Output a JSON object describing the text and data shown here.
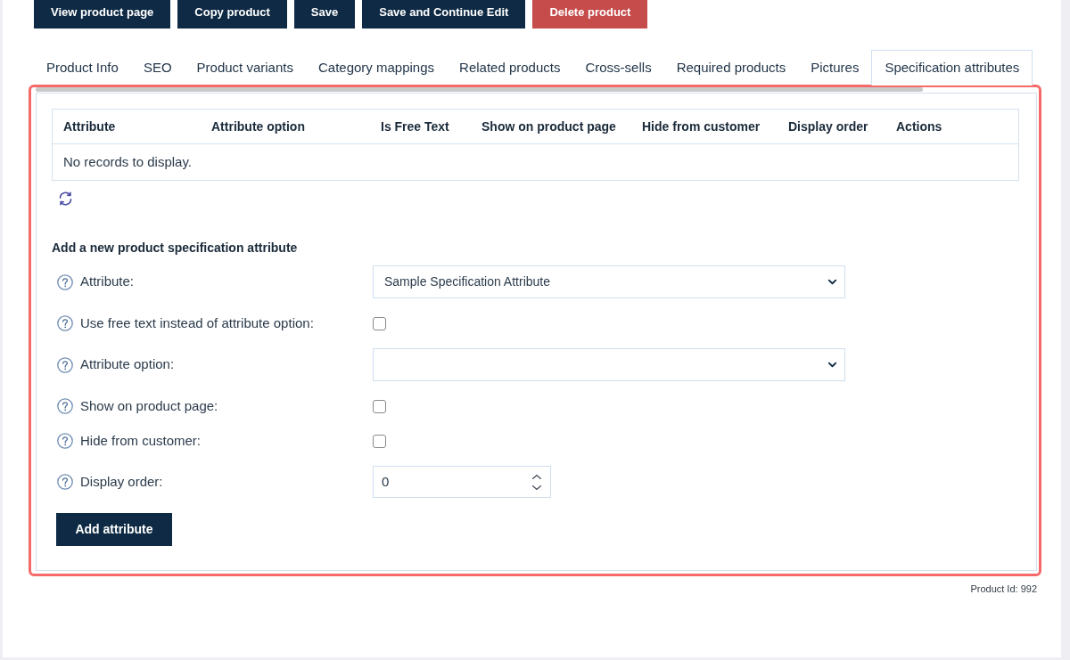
{
  "toolbar": {
    "buttons": [
      {
        "label": "View product page",
        "kind": "primary"
      },
      {
        "label": "Copy product",
        "kind": "primary"
      },
      {
        "label": "Save",
        "kind": "primary"
      },
      {
        "label": "Save and Continue Edit",
        "kind": "primary"
      },
      {
        "label": "Delete product",
        "kind": "danger"
      }
    ]
  },
  "tabs": [
    {
      "label": "Product Info",
      "selected": false
    },
    {
      "label": "SEO",
      "selected": false
    },
    {
      "label": "Product variants",
      "selected": false
    },
    {
      "label": "Category mappings",
      "selected": false
    },
    {
      "label": "Related products",
      "selected": false
    },
    {
      "label": "Cross-sells",
      "selected": false
    },
    {
      "label": "Required products",
      "selected": false
    },
    {
      "label": "Pictures",
      "selected": false
    },
    {
      "label": "Specification attributes",
      "selected": true
    }
  ],
  "specification_attributes": {
    "table": {
      "columns": [
        "Attribute",
        "Attribute option",
        "Is Free Text",
        "Show on product page",
        "Hide from customer",
        "Display order",
        "Actions"
      ],
      "empty_message": "No records to display."
    },
    "add_form": {
      "title": "Add a new product specification attribute",
      "fields": [
        {
          "kind": "select",
          "label": "Attribute:",
          "value": "Sample Specification Attribute"
        },
        {
          "kind": "checkbox",
          "label": "Use free text instead of attribute option:",
          "checked": false
        },
        {
          "kind": "select",
          "label": "Attribute option:"
        },
        {
          "kind": "checkbox",
          "label": "Show on product page:",
          "checked": false
        },
        {
          "kind": "checkbox",
          "label": "Hide from customer:",
          "checked": false
        },
        {
          "kind": "number",
          "label": "Display order:",
          "value": "0"
        }
      ],
      "submit_button": "Add attribute"
    }
  },
  "footer": {
    "product_id": "Product Id: 992"
  }
}
